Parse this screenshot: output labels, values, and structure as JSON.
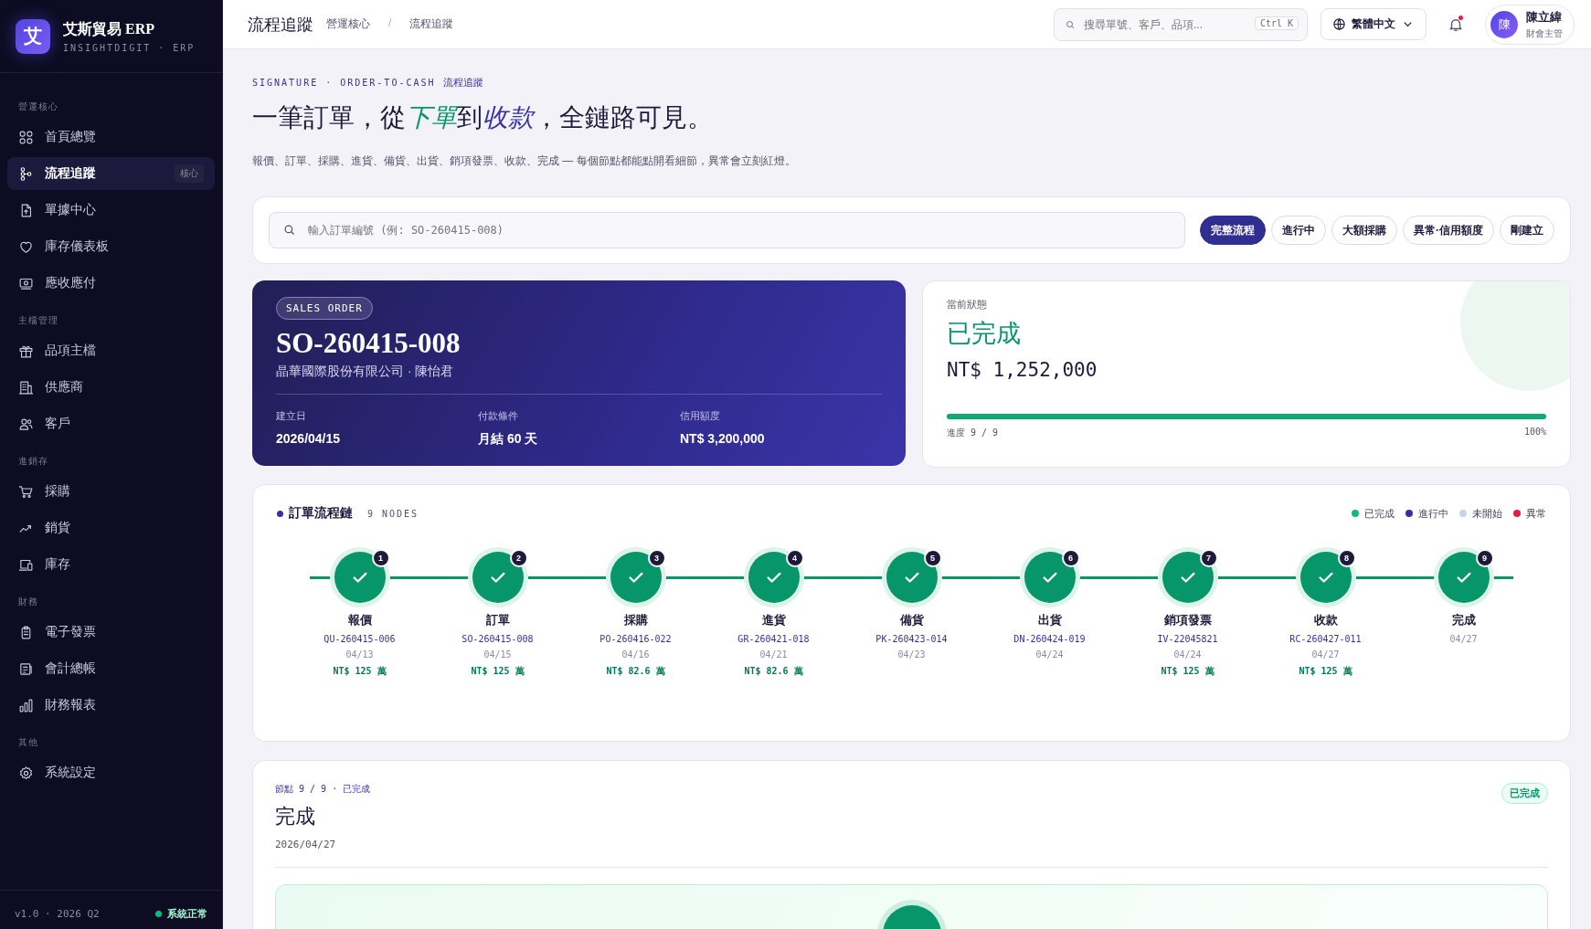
{
  "brand": {
    "logo": "艾",
    "name": "艾斯貿易 ERP",
    "sub": "INSIGHTDIGIT · ERP"
  },
  "sidebar": {
    "sections": [
      {
        "title": "營運核心",
        "items": [
          {
            "label": "首頁總覽",
            "selected": false
          },
          {
            "label": "流程追蹤",
            "selected": true,
            "badge": "核心"
          },
          {
            "label": "單據中心",
            "selected": false
          },
          {
            "label": "庫存儀表板",
            "selected": false
          },
          {
            "label": "應收應付",
            "selected": false
          }
        ]
      },
      {
        "title": "主檔管理",
        "items": [
          {
            "label": "品項主檔",
            "selected": false
          },
          {
            "label": "供應商",
            "selected": false
          },
          {
            "label": "客戶",
            "selected": false
          }
        ]
      },
      {
        "title": "進銷存",
        "items": [
          {
            "label": "採購",
            "selected": false
          },
          {
            "label": "銷貨",
            "selected": false
          },
          {
            "label": "庫存",
            "selected": false
          }
        ]
      },
      {
        "title": "財務",
        "items": [
          {
            "label": "電子發票",
            "selected": false
          },
          {
            "label": "會計總帳",
            "selected": false
          },
          {
            "label": "財務報表",
            "selected": false
          }
        ]
      },
      {
        "title": "其他",
        "items": [
          {
            "label": "系統設定",
            "selected": false
          }
        ]
      }
    ],
    "version": "v1.0 · 2026 Q2",
    "system": {
      "label": "系統正常",
      "color": "#10b981"
    }
  },
  "topbar": {
    "title": "流程追蹤",
    "breadcrumb": [
      "營運核心",
      "流程追蹤"
    ],
    "breadcrumb_sep": "/",
    "search_placeholder": "搜尋單號、客戶、品項...",
    "shortcut": "Ctrl K",
    "language": "繁體中文",
    "notification": true,
    "user": {
      "avatar": "陳",
      "name": "陳立緯",
      "role": "財會主管"
    }
  },
  "header": {
    "eyebrow": "SIGNATURE · ORDER-TO-CASH",
    "eyebrow_tag": "流程追蹤",
    "title": [
      {
        "text": "一筆訂單，從",
        "italic": false
      },
      {
        "text": "下單",
        "italic": true,
        "color": "#059669"
      },
      {
        "text": "到",
        "italic": false
      },
      {
        "text": "收款",
        "italic": true,
        "color": "#3730a3"
      },
      {
        "text": "，全鏈路可見。",
        "italic": false
      }
    ],
    "subtitle": "報價、訂單、採購、進貨、備貨、出貨、銷項發票、收款、完成 — 每個節點都能點開看細節，異常會立刻紅燈。"
  },
  "order_search": {
    "placeholder": "輸入訂單編號 (例: SO-260415-008)",
    "filters": [
      {
        "label": "完整流程",
        "selected": true
      },
      {
        "label": "進行中",
        "selected": false
      },
      {
        "label": "大額採購",
        "selected": false
      },
      {
        "label": "異常·信用額度",
        "selected": false
      },
      {
        "label": "剛建立",
        "selected": false
      }
    ]
  },
  "order": {
    "tag": "SALES ORDER",
    "number": "SO-260415-008",
    "customer": "晶華國際股份有限公司 · 陳怡君",
    "fields": [
      {
        "label": "建立日",
        "value": "2026/04/15"
      },
      {
        "label": "付款條件",
        "value": "月結 60 天"
      },
      {
        "label": "信用額度",
        "value": "NT$ 3,200,000"
      }
    ]
  },
  "status_card": {
    "label": "當前狀態",
    "status": "已完成",
    "amount": "NT$ 1,252,000",
    "level": 1,
    "progress_label": "進度 9 / 9",
    "percent": "100%"
  },
  "chain": {
    "title": "訂單流程鏈",
    "count": "9 NODES",
    "legend": [
      {
        "label": "已完成",
        "color": "#10b981"
      },
      {
        "label": "進行中",
        "color": "#3730a3"
      },
      {
        "label": "未開始",
        "color": "#cbd5e1"
      },
      {
        "label": "異常",
        "color": "#e11d48"
      }
    ],
    "nodes": [
      {
        "number": "1",
        "name": "報價",
        "doc": "QU-260415-006",
        "date": "04/13",
        "amount": "NT$ 125 萬",
        "completed": true
      },
      {
        "number": "2",
        "name": "訂單",
        "doc": "SO-260415-008",
        "date": "04/15",
        "amount": "NT$ 125 萬",
        "completed": true
      },
      {
        "number": "3",
        "name": "採購",
        "doc": "PO-260416-022",
        "date": "04/16",
        "amount": "NT$ 82.6 萬",
        "completed": true
      },
      {
        "number": "4",
        "name": "進貨",
        "doc": "GR-260421-018",
        "date": "04/21",
        "amount": "NT$ 82.6 萬",
        "completed": true
      },
      {
        "number": "5",
        "name": "備貨",
        "doc": "PK-260423-014",
        "date": "04/23",
        "completed": true
      },
      {
        "number": "6",
        "name": "出貨",
        "doc": "DN-260424-019",
        "date": "04/24",
        "completed": true
      },
      {
        "number": "7",
        "name": "銷項發票",
        "doc": "IV-22045821",
        "date": "04/24",
        "amount": "NT$ 125 萬",
        "completed": true
      },
      {
        "number": "8",
        "name": "收款",
        "doc": "RC-260427-011",
        "date": "04/27",
        "amount": "NT$ 125 萬",
        "completed": true
      },
      {
        "number": "9",
        "name": "完成",
        "date": "04/27",
        "completed": true
      }
    ]
  },
  "detail": {
    "eyebrow": "節點 9 / 9 · 已完成",
    "title": "完成",
    "date": "2026/04/27",
    "badge": "已完成",
    "completed": true
  }
}
